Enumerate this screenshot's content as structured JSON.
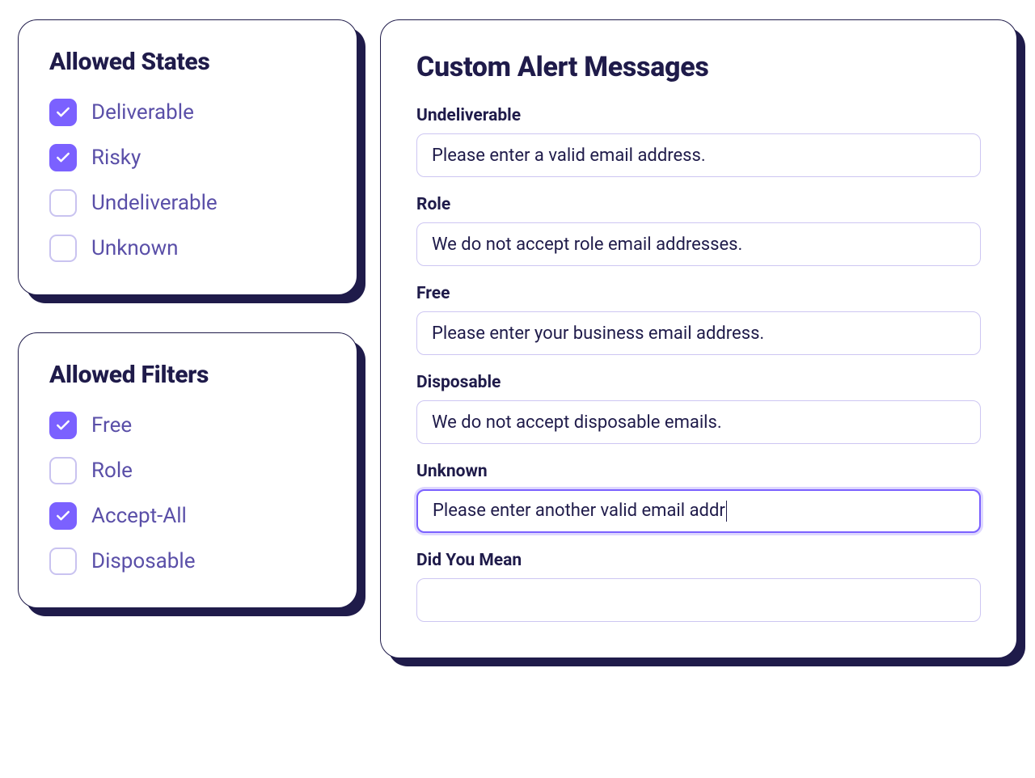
{
  "allowed_states": {
    "title": "Allowed States",
    "items": [
      {
        "label": "Deliverable",
        "checked": true
      },
      {
        "label": "Risky",
        "checked": true
      },
      {
        "label": "Undeliverable",
        "checked": false
      },
      {
        "label": "Unknown",
        "checked": false
      }
    ]
  },
  "allowed_filters": {
    "title": "Allowed Filters",
    "items": [
      {
        "label": "Free",
        "checked": true
      },
      {
        "label": "Role",
        "checked": false
      },
      {
        "label": "Accept-All",
        "checked": true
      },
      {
        "label": "Disposable",
        "checked": false
      }
    ]
  },
  "custom_alerts": {
    "title": "Custom Alert Messages",
    "fields": [
      {
        "label": "Undeliverable",
        "value": "Please enter a valid email address.",
        "focused": false
      },
      {
        "label": "Role",
        "value": "We do not accept role email addresses.",
        "focused": false
      },
      {
        "label": "Free",
        "value": "Please enter your business email address.",
        "focused": false
      },
      {
        "label": "Disposable",
        "value": "We do not accept disposable emails.",
        "focused": false
      },
      {
        "label": "Unknown",
        "value": "Please enter another valid email addr",
        "focused": true
      },
      {
        "label": "Did You Mean",
        "value": "",
        "focused": false
      }
    ]
  }
}
